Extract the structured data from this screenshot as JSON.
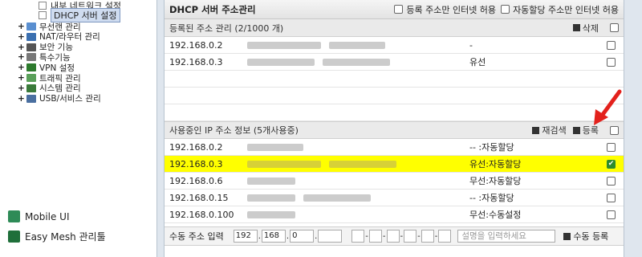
{
  "sidebar": {
    "tree_children": [
      {
        "label": "내부 네트워크 설정",
        "selected": false
      },
      {
        "label": "DHCP 서버 설정",
        "selected": true
      }
    ],
    "tree_items": [
      {
        "label": "무선랜 관리",
        "icon": "wireless-icon",
        "color": "#5a8fd0"
      },
      {
        "label": "NAT/라우터 관리",
        "icon": "router-icon",
        "color": "#3a6fb0"
      },
      {
        "label": "보안 기능",
        "icon": "lock-icon",
        "color": "#555555"
      },
      {
        "label": "특수기능",
        "icon": "special-icon",
        "color": "#777777"
      },
      {
        "label": "VPN 설정",
        "icon": "vpn-icon",
        "color": "#2d7a2d"
      },
      {
        "label": "트래픽 관리",
        "icon": "traffic-icon",
        "color": "#5aa05a"
      },
      {
        "label": "시스템 관리",
        "icon": "system-icon",
        "color": "#3a7a3a"
      },
      {
        "label": "USB/서비스 관리",
        "icon": "usb-icon",
        "color": "#4a6fa0"
      }
    ],
    "mobile_ui": "Mobile UI",
    "easy_mesh": "Easy Mesh 관리툴"
  },
  "panel": {
    "title": "DHCP 서버 주소관리",
    "opt_registered_only": "등록 주소만 인터넷 허용",
    "opt_auto_only": "자동할당 주소만 인터넷 허용"
  },
  "registered": {
    "header": "등록된 주소 관리 (2/1000 개)",
    "delete_label": "삭제",
    "rows": [
      {
        "ip": "192.168.0.2",
        "status": "-"
      },
      {
        "ip": "192.168.0.3",
        "status": "유선"
      }
    ]
  },
  "in_use": {
    "header": "사용중인 IP 주소 정보 (5개사용중)",
    "rescan_label": "재검색",
    "register_label": "등록",
    "rows": [
      {
        "ip": "192.168.0.2",
        "status": "-- :자동할당",
        "checked": false,
        "highlight": false
      },
      {
        "ip": "192.168.0.3",
        "status": "유선:자동할당",
        "checked": true,
        "highlight": true
      },
      {
        "ip": "192.168.0.6",
        "status": "무선:자동할당",
        "checked": false,
        "highlight": false
      },
      {
        "ip": "192.168.0.15",
        "status": "-- :자동할당",
        "checked": false,
        "highlight": false
      },
      {
        "ip": "192.168.0.100",
        "status": "무선:수동설정",
        "checked": false,
        "highlight": false
      }
    ]
  },
  "manual": {
    "label": "수동 주소 입력",
    "oct1": "192",
    "oct2": "168",
    "oct3": "0",
    "oct4": "",
    "desc_placeholder": "설명을 입력하세요",
    "submit_label": "수동 등록"
  },
  "colors": {
    "highlight": "#ffff00",
    "arrow": "#e3211c"
  }
}
